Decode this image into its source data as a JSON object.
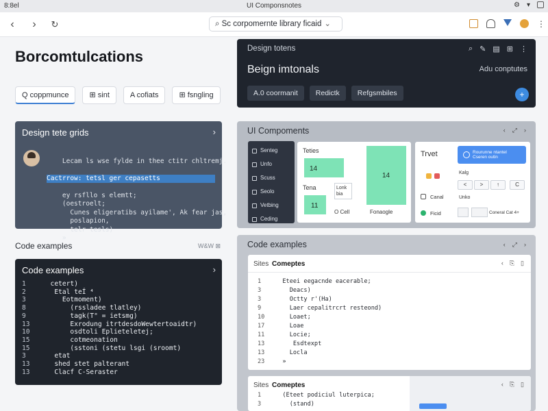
{
  "status": {
    "left": "8:8el",
    "center": "UI Componsnotes"
  },
  "browser": {
    "address": "Sc corpomernte library ficaid"
  },
  "page": {
    "title": "Borcomtulcations",
    "chips": [
      {
        "icon": "search-icon",
        "label": "Q coppmunce"
      },
      {
        "icon": "grid-icon",
        "label": "⊞ sint"
      },
      {
        "icon": "",
        "label": "A cofiats"
      },
      {
        "icon": "grid-icon",
        "label": "⊞ fsngling"
      }
    ]
  },
  "design_card": {
    "header": "Design totens",
    "title": "Beign imtonals",
    "add_label": "Adu conptutes",
    "buttons": [
      "A.0 coormanit",
      "Redictk",
      "Refgsmbiles"
    ]
  },
  "grid_card": {
    "title": "Design tete grids",
    "lines": [
      "Lecam ls wse fylde in thee ctitr chltremj.",
      "Cactrrow: tetsl ger cepasetts",
      "ey rsfllo s elemtt;",
      "(oestroelt;",
      "  Cunes eligeratibs ayilame', Ak fear jas,",
      "  poslapion,",
      "  telr tesls)",
      "»"
    ],
    "highlight_index": 1
  },
  "code_section": {
    "label": "Code examples",
    "label_right": "W&W ⊠"
  },
  "code_card": {
    "title": "Code examples",
    "rows": [
      {
        "n": "1",
        "t": "  cetert)"
      },
      {
        "n": "2",
        "t": "   Etal teÍ ⁴"
      },
      {
        "n": "3",
        "t": "     Eotmoment)"
      },
      {
        "n": "8",
        "t": "       (rssladee tlatley)"
      },
      {
        "n": "9",
        "t": "       tagk(T\" = ietsmg)"
      },
      {
        "n": "13",
        "t": "       Exrodung itrtdesdoWewtertoaidtr)"
      },
      {
        "n": "10",
        "t": "       osdtoli Eplieteletej;"
      },
      {
        "n": "15",
        "t": "       cotmeonation"
      },
      {
        "n": "15",
        "t": "       (sstoni (stetu lsgi (sroomt)"
      },
      {
        "n": "3",
        "t": "   etat"
      },
      {
        "n": "13",
        "t": "   shed stet palterant"
      },
      {
        "n": "13",
        "t": "   Clacf C-Seraster"
      }
    ]
  },
  "ui_components": {
    "title": "UI Compoments",
    "menu": [
      "Senteg",
      "Unfo",
      "Scuss",
      "Seolo",
      "Vetbing",
      "Ceding"
    ],
    "panel_a": {
      "title": "Teties",
      "num1": "14",
      "num2": "14",
      "num3": "11",
      "label_tera": "Tena",
      "label_link": "Lonk\nbia",
      "label_cell": "O Cell",
      "label_frag": "Fonaogle"
    },
    "panel_b": {
      "title": "Trvet",
      "blue_btn": "Rourunne ntantel\nCseren outin",
      "label_kalg": "Kalg",
      "label_cansal": "Canal",
      "label_ficid": "Ficid",
      "label_unko": "Unko",
      "label_concal": "Coneral Cat 4+",
      "seg": [
        "<",
        ">",
        "↑",
        "C"
      ]
    }
  },
  "code_examples_panel": {
    "title": "Code examples",
    "inner1": {
      "tab1": "Sites",
      "tab2": "Comeptes",
      "rows": [
        {
          "n": "1",
          "t": "  Eteei eegacnde eacerable;"
        },
        {
          "n": "3",
          "t": "    Deacs)"
        },
        {
          "n": "3",
          "t": "    Octty r'(Ha)"
        },
        {
          "n": "9",
          "t": "    Laer cepalitrcrt resteond)"
        },
        {
          "n": "10",
          "t": "    Loaet;"
        },
        {
          "n": "17",
          "t": "    Loae"
        },
        {
          "n": "11",
          "t": "    Locie;"
        },
        {
          "n": "13",
          "t": "     Esdtexpt"
        },
        {
          "n": "13",
          "t": "    Locla"
        },
        {
          "n": "23",
          "t": "  »"
        }
      ]
    },
    "inner2": {
      "tab1": "Sites",
      "tab2": "Comeptes",
      "rows": [
        {
          "n": "1",
          "t": "  (Eteet podiciul luterpica;"
        },
        {
          "n": "3",
          "t": "    (stand)"
        }
      ]
    }
  },
  "colors": {
    "accent": "#3d8be0",
    "dark_card": "#1f242d",
    "green": "#7ee3b6"
  }
}
